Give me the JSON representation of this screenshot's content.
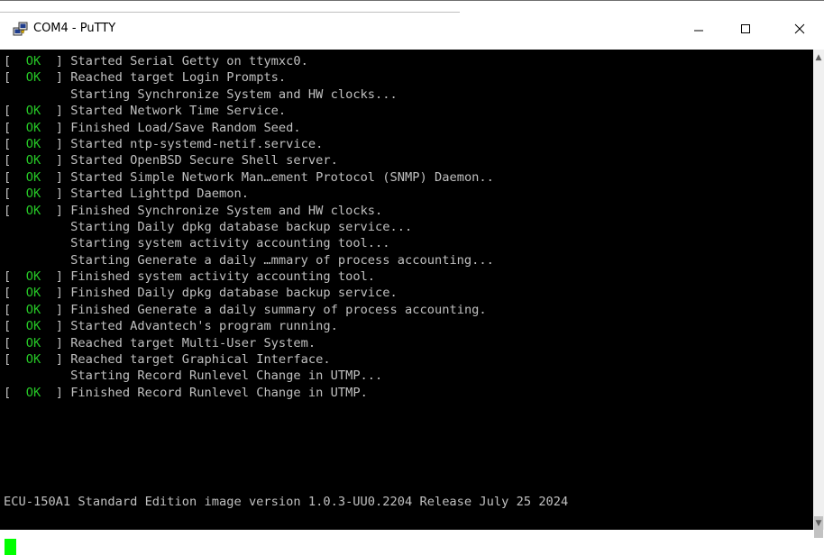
{
  "window": {
    "title": "COM4 - PuTTY",
    "minimize_icon": "minimize-icon",
    "maximize_icon": "maximize-icon",
    "close_icon": "close-icon",
    "app_icon": "putty-icon"
  },
  "terminal": {
    "lines": [
      {
        "status": "OK",
        "text": "Started Serial Getty on ttymxc0."
      },
      {
        "status": "OK",
        "text": "Reached target Login Prompts."
      },
      {
        "status": "",
        "text": "Starting Synchronize System and HW clocks..."
      },
      {
        "status": "OK",
        "text": "Started Network Time Service."
      },
      {
        "status": "OK",
        "text": "Finished Load/Save Random Seed."
      },
      {
        "status": "OK",
        "text": "Started ntp-systemd-netif.service."
      },
      {
        "status": "OK",
        "text": "Started OpenBSD Secure Shell server."
      },
      {
        "status": "OK",
        "text": "Started Simple Network Man…ement Protocol (SNMP) Daemon.."
      },
      {
        "status": "OK",
        "text": "Started Lighttpd Daemon."
      },
      {
        "status": "OK",
        "text": "Finished Synchronize System and HW clocks."
      },
      {
        "status": "",
        "text": "Starting Daily dpkg database backup service..."
      },
      {
        "status": "",
        "text": "Starting system activity accounting tool..."
      },
      {
        "status": "",
        "text": "Starting Generate a daily …mmary of process accounting..."
      },
      {
        "status": "OK",
        "text": "Finished system activity accounting tool."
      },
      {
        "status": "OK",
        "text": "Finished Daily dpkg database backup service."
      },
      {
        "status": "OK",
        "text": "Finished Generate a daily summary of process accounting."
      },
      {
        "status": "OK",
        "text": "Started Advantech's program running."
      },
      {
        "status": "OK",
        "text": "Reached target Multi-User System."
      },
      {
        "status": "OK",
        "text": "Reached target Graphical Interface."
      },
      {
        "status": "",
        "text": "Starting Record Runlevel Change in UTMP..."
      },
      {
        "status": "OK",
        "text": "Finished Record Runlevel Change in UTMP."
      }
    ],
    "banner": "ECU-150A1 Standard Edition image version 1.0.3-UU0.2204 Release July 25 2024",
    "colors": {
      "background": "#000000",
      "text": "#c0c0c0",
      "ok": "#26c726",
      "cursor": "#00ff00"
    }
  }
}
